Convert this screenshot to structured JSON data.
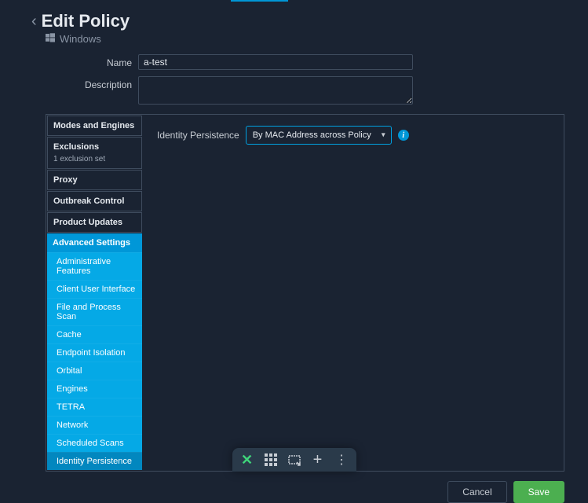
{
  "header": {
    "title": "Edit Policy",
    "subtitle": "Windows",
    "back_icon": "‹"
  },
  "form": {
    "name_label": "Name",
    "name_value": "a-test",
    "description_label": "Description",
    "description_value": ""
  },
  "sidebar": {
    "groups": [
      {
        "label": "Modes and Engines",
        "sub": ""
      },
      {
        "label": "Exclusions",
        "sub": "1 exclusion set"
      },
      {
        "label": "Proxy",
        "sub": ""
      }
    ],
    "outbreak": "Outbreak Control",
    "updates": "Product Updates",
    "advanced_header": "Advanced Settings",
    "advanced_items": [
      "Administrative Features",
      "Client User Interface",
      "File and Process Scan",
      "Cache",
      "Endpoint Isolation",
      "Orbital",
      "Engines",
      "TETRA",
      "Network",
      "Scheduled Scans",
      "Identity Persistence"
    ],
    "advanced_selected": "Identity Persistence"
  },
  "content": {
    "identity_label": "Identity Persistence",
    "identity_selected": "By MAC Address across Policy",
    "info_glyph": "i"
  },
  "footer": {
    "cancel": "Cancel",
    "save": "Save"
  },
  "toolbar": {
    "close": "✕",
    "plus": "+",
    "dots": "⋮"
  }
}
